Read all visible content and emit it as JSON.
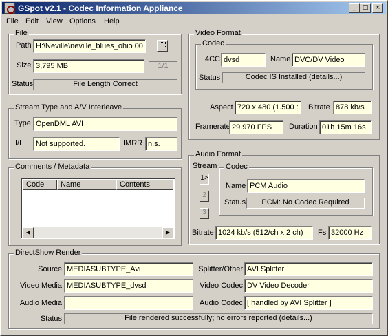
{
  "window": {
    "title": "GSpot v2.1 - Codec Information Appliance",
    "minimize": "_",
    "maximize": "□",
    "close": "×"
  },
  "menu": {
    "file": "File",
    "edit": "Edit",
    "view": "View",
    "options": "Options",
    "help": "Help"
  },
  "file": {
    "group_label": "File",
    "path_label": "Path",
    "path_value": "H:\\Neville\\neville_blues_ohio 00",
    "browse_label": "...",
    "size_label": "Size",
    "size_value": "3,795 MB",
    "part_label": "1/1",
    "status_label": "Status",
    "status_value": "File Length Correct"
  },
  "stream": {
    "group_label": "Stream Type and A/V Interleave",
    "type_label": "Type",
    "type_value": "OpenDML AVI",
    "il_label": "I/L",
    "il_value": "Not supported.",
    "imrr_label": "IMRR",
    "imrr_value": "n.s."
  },
  "comments": {
    "group_label": "Comments / Metadata",
    "columns": [
      "Code",
      "Name",
      "Contents"
    ]
  },
  "video": {
    "group_label": "Video Format",
    "codec_group_label": "Codec",
    "fourcc_label": "4CC",
    "fourcc_value": "dvsd",
    "name_label": "Name",
    "name_value": "DVC/DV Video",
    "status_label": "Status",
    "status_value": "Codec IS Installed  (details...)",
    "aspect_label": "Aspect",
    "aspect_value": "720 x 480  (1.500 :",
    "bitrate_label": "Bitrate",
    "bitrate_value": "878 kb/s",
    "framerate_label": "Framerate",
    "framerate_value": "29.970 FPS",
    "duration_label": "Duration",
    "duration_value": "01h 15m 16s"
  },
  "audio": {
    "group_label": "Audio Format",
    "stream_label": "Stream",
    "stream_buttons": [
      "1>",
      "2",
      "3"
    ],
    "codec_group_label": "Codec",
    "name_label": "Name",
    "name_value": "PCM Audio",
    "status_label": "Status",
    "status_value": "PCM: No Codec Required",
    "bitrate_label": "Bitrate",
    "bitrate_value": "1024 kb/s (512/ch x 2 ch)",
    "fs_label": "Fs",
    "fs_value": "32000 Hz"
  },
  "directshow": {
    "group_label": "DirectShow Render",
    "source_label": "Source",
    "source_value": "MEDIASUBTYPE_Avi",
    "splitter_label": "Splitter/Other",
    "splitter_value": "AVI Splitter",
    "video_media_label": "Video Media",
    "video_media_value": "MEDIASUBTYPE_dvsd",
    "video_codec_label": "Video Codec",
    "video_codec_value": "DV Video Decoder",
    "audio_media_label": "Audio Media",
    "audio_media_value": "",
    "audio_codec_label": "Audio Codec",
    "audio_codec_value": "[ handled by AVI Splitter ]",
    "status_label": "Status",
    "status_value": "File rendered successfully; no errors reported   (details...)"
  }
}
